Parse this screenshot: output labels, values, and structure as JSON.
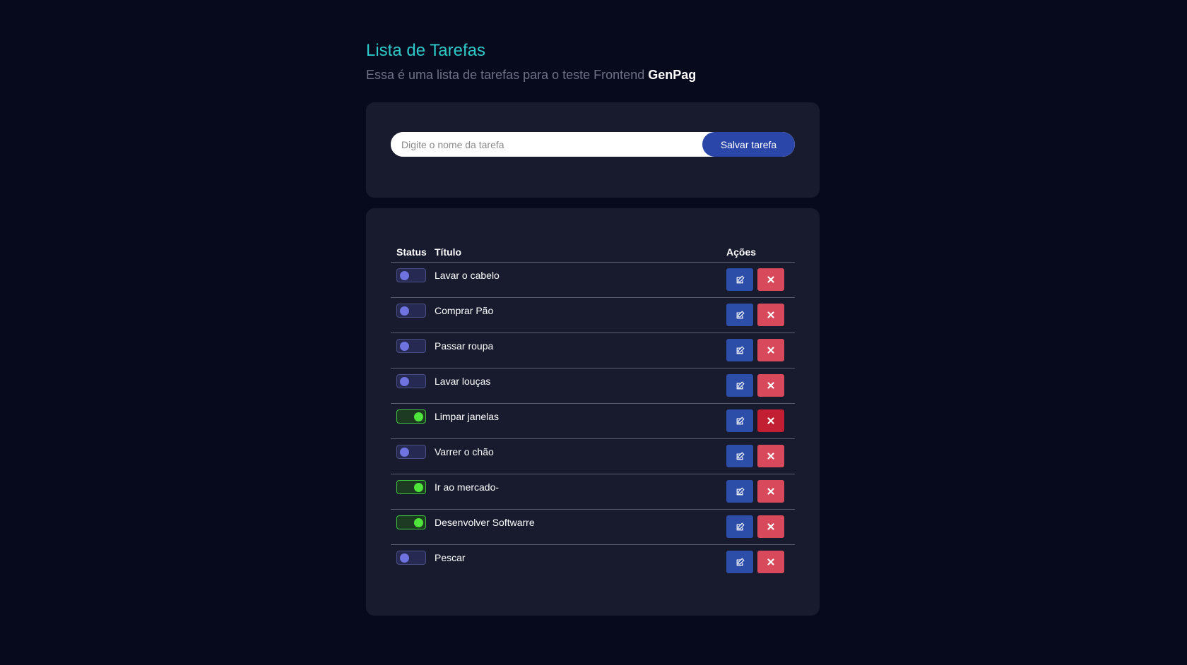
{
  "header": {
    "title": "Lista de Tarefas",
    "subtitle_prefix": "Essa é uma lista de tarefas para o teste Frontend ",
    "subtitle_brand": "GenPag"
  },
  "form": {
    "placeholder": "Digite o nome da tarefa",
    "value": "",
    "save_label": "Salvar tarefa"
  },
  "table": {
    "headers": {
      "status": "Status",
      "title": "Título",
      "actions": "Ações"
    },
    "rows": [
      {
        "title": "Lavar o cabelo",
        "done": false
      },
      {
        "title": "Comprar Pão",
        "done": false
      },
      {
        "title": "Passar roupa",
        "done": false
      },
      {
        "title": "Lavar louças",
        "done": false
      },
      {
        "title": "Limpar janelas",
        "done": true
      },
      {
        "title": "Varrer o chão",
        "done": false
      },
      {
        "title": "Ir ao mercado-",
        "done": true
      },
      {
        "title": "Desenvolver Softwarre",
        "done": true
      },
      {
        "title": "Pescar",
        "done": false
      }
    ]
  },
  "colors": {
    "accent": "#2ec9c9",
    "primary_button": "#2a46a8",
    "edit_button": "#2d4ea8",
    "delete_button": "#d8495b",
    "toggle_on": "#4ee63a",
    "toggle_off": "#6e73e0"
  },
  "icons": {
    "edit": "edit-icon",
    "delete": "close-icon"
  }
}
